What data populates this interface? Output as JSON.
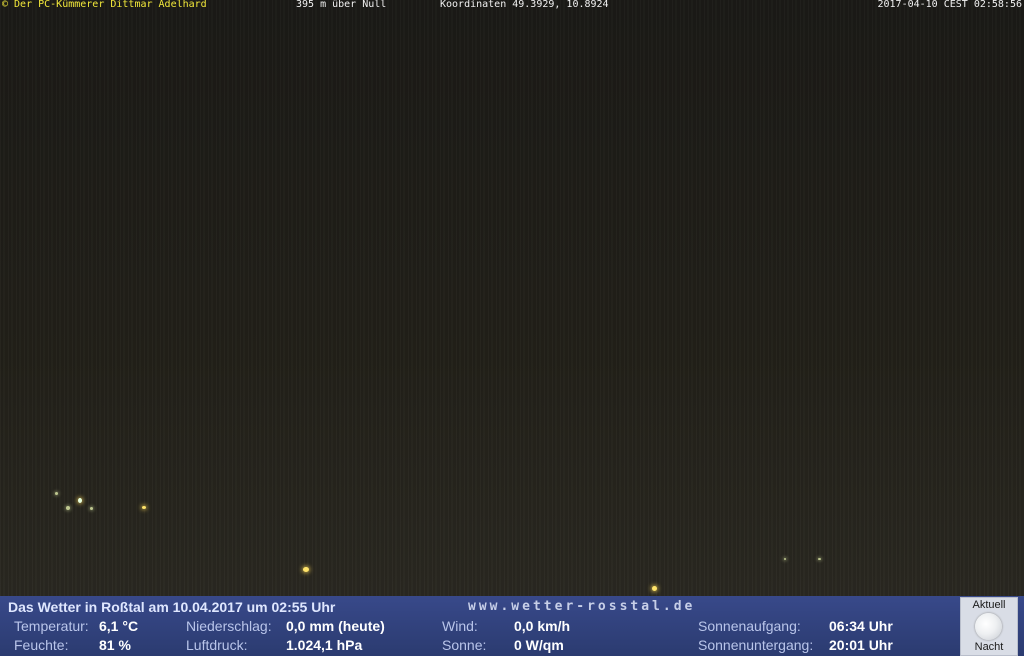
{
  "overlay": {
    "author": "© Der PC-Kümmerer Dittmar Adelhard",
    "altitude": "395 m über Null",
    "coordinates": "Koordinaten 49.3929, 10.8924",
    "timestamp": "2017-04-10 CEST 02:58:56"
  },
  "panel": {
    "title": "Das Wetter in Roßtal am 10.04.2017 um 02:55 Uhr",
    "site": "www.wetter-rosstal.de",
    "temperature": {
      "label": "Temperatur:",
      "value": "6,1 °C"
    },
    "humidity": {
      "label": "Feuchte:",
      "value": "81 %"
    },
    "precipitation": {
      "label": "Niederschlag:",
      "value": "0,0 mm (heute)"
    },
    "pressure": {
      "label": "Luftdruck:",
      "value": "1.024,1 hPa"
    },
    "wind": {
      "label": "Wind:",
      "value": "0,0 km/h"
    },
    "sun": {
      "label": "Sonne:",
      "value": "0 W/qm"
    },
    "sunrise": {
      "label": "Sonnenaufgang:",
      "value": "06:34 Uhr"
    },
    "sunset": {
      "label": "Sonnenuntergang:",
      "value": "20:01 Uhr"
    },
    "moon": {
      "top_label": "Aktuell",
      "bottom_label": "Nacht",
      "icon": "full-moon-icon"
    }
  },
  "colors": {
    "panel_background": "#2e3e72",
    "author_text": "#f2e83a",
    "overlay_text": "#f0f0f0"
  }
}
